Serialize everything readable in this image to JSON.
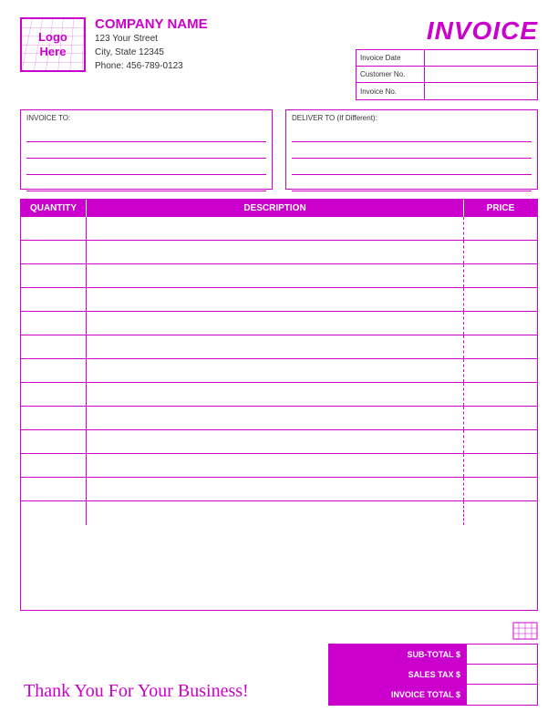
{
  "company": {
    "name": "COMPANY NAME",
    "street": "123 Your Street",
    "citystatezip": "City, State 12345",
    "phone": "Phone: 456-789-0123",
    "logo_line1": "Logo",
    "logo_line2": "Here"
  },
  "header": {
    "invoice_title": "INVOICE",
    "fields": [
      {
        "label": "Invoice Date",
        "value": ""
      },
      {
        "label": "Customer No.",
        "value": ""
      },
      {
        "label": "Invoice No.",
        "value": ""
      }
    ]
  },
  "address": {
    "invoice_to_label": "INVOICE TO:",
    "deliver_to_label": "DELIVER TO (If Different):"
  },
  "table": {
    "col_quantity": "QUANTITY",
    "col_description": "DESCRIPTION",
    "col_price": "PRICE",
    "rows": [
      {
        "qty": "",
        "desc": "",
        "price": ""
      },
      {
        "qty": "",
        "desc": "",
        "price": ""
      },
      {
        "qty": "",
        "desc": "",
        "price": ""
      },
      {
        "qty": "",
        "desc": "",
        "price": ""
      },
      {
        "qty": "",
        "desc": "",
        "price": ""
      },
      {
        "qty": "",
        "desc": "",
        "price": ""
      },
      {
        "qty": "",
        "desc": "",
        "price": ""
      },
      {
        "qty": "",
        "desc": "",
        "price": ""
      },
      {
        "qty": "",
        "desc": "",
        "price": ""
      },
      {
        "qty": "",
        "desc": "",
        "price": ""
      },
      {
        "qty": "",
        "desc": "",
        "price": ""
      },
      {
        "qty": "",
        "desc": "",
        "price": ""
      },
      {
        "qty": "",
        "desc": "",
        "price": ""
      }
    ]
  },
  "totals": {
    "subtotal_label": "SUB-TOTAL $",
    "salestax_label": "SALES TAX $",
    "invoicetotal_label": "INVOICE TOTAL $"
  },
  "footer": {
    "thank_you": "Thank You For Your Business!"
  },
  "colors": {
    "accent": "#cc00cc"
  }
}
